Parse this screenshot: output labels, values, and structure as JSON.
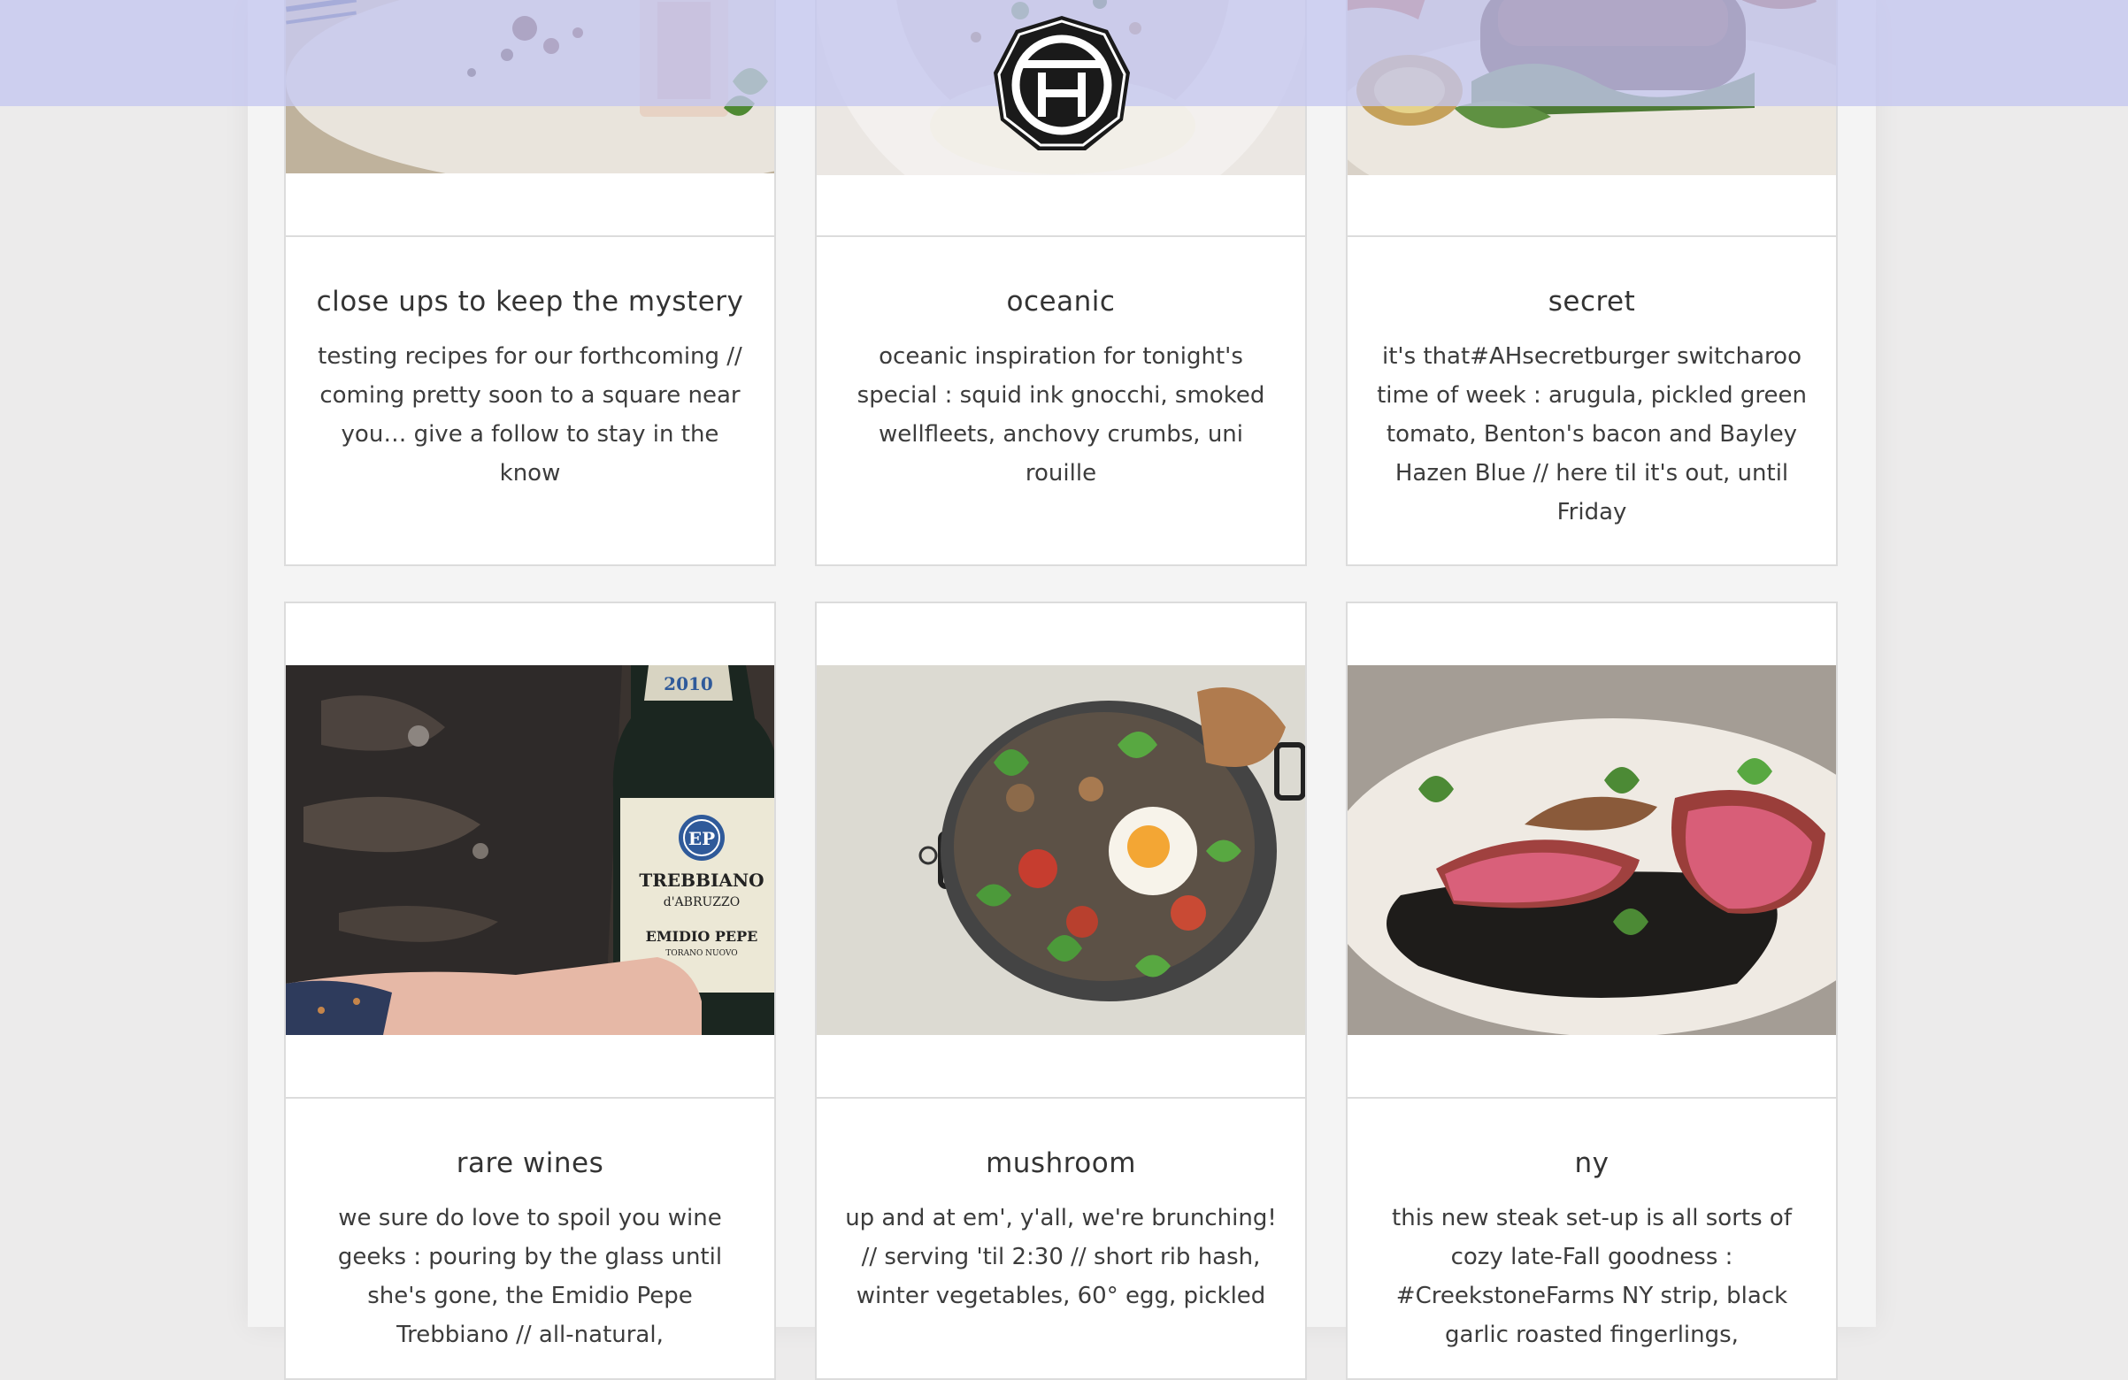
{
  "header": {
    "logo_icon": "ah-monogram-logo-icon"
  },
  "posts": [
    {
      "title": "close ups to keep the mystery",
      "description": "testing recipes for our forthcoming // coming pretty soon to a square near you… give a follow to stay in the know",
      "image_icon": "dessert-plate-photo"
    },
    {
      "title": "oceanic",
      "description": "oceanic inspiration for tonight's special : squid ink gnocchi, smoked wellfleets, anchovy crumbs, uni rouille",
      "image_icon": "gnocchi-bowl-photo"
    },
    {
      "title": "secret",
      "description": "it's that#AHsecretburger switcharoo time of week : arugula, pickled green tomato, Benton's bacon and Bayley Hazen Blue // here til it's out, until Friday",
      "image_icon": "burger-photo"
    },
    {
      "title": "rare wines",
      "description": "we sure do love to spoil you wine geeks : pouring by the glass until she's gone, the Emidio Pepe Trebbiano // all-natural,",
      "image_icon": "wine-bottle-photo",
      "bottle_label": {
        "vintage": "2010",
        "monogram": "EP",
        "name": "TREBBIANO",
        "region": "d'ABRUZZO",
        "producer": "EMIDIO PEPE",
        "town": "TORANO NUOVO"
      }
    },
    {
      "title": "mushroom",
      "description": "up and at em', y'all, we're brunching! // serving 'til 2:30 // short rib hash, winter vegetables, 60° egg, pickled",
      "image_icon": "brunch-skillet-photo"
    },
    {
      "title": "ny",
      "description": "this new steak set-up is all sorts of cozy late-Fall goodness : #CreekstoneFarms NY strip, black garlic roasted fingerlings,",
      "image_icon": "steak-plate-photo"
    }
  ],
  "colors": {
    "page_background": "#ecebeb",
    "column_background": "#f4f4f4",
    "card_border": "#dcdcdc",
    "header_overlay": "#c4c6f0",
    "text": "#3a3a3a"
  }
}
